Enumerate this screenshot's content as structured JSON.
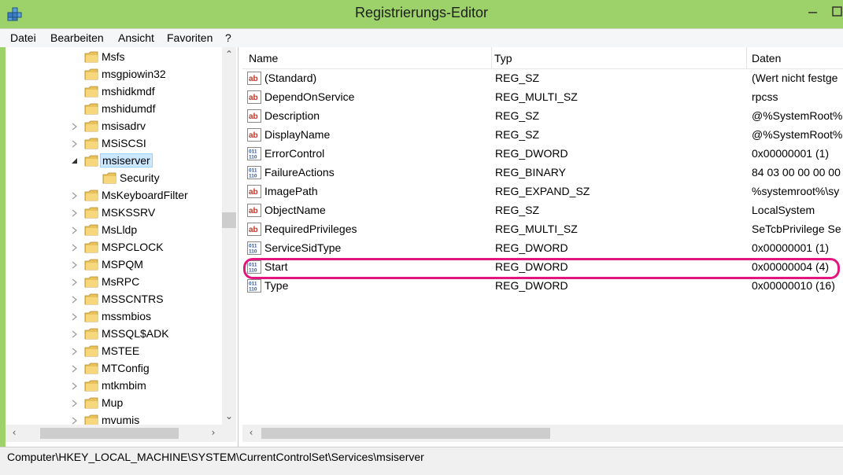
{
  "window": {
    "title": "Registrierungs-Editor"
  },
  "menu": [
    "Datei",
    "Bearbeiten",
    "Ansicht",
    "Favoriten",
    "?"
  ],
  "tree": [
    {
      "label": "Msfs",
      "expander": "none",
      "level": 1
    },
    {
      "label": "msgpiowin32",
      "expander": "none",
      "level": 1
    },
    {
      "label": "mshidkmdf",
      "expander": "none",
      "level": 1
    },
    {
      "label": "mshidumdf",
      "expander": "none",
      "level": 1
    },
    {
      "label": "msisadrv",
      "expander": "collapsed",
      "level": 1
    },
    {
      "label": "MSiSCSI",
      "expander": "collapsed",
      "level": 1
    },
    {
      "label": "msiserver",
      "expander": "expanded",
      "level": 1,
      "selected": true
    },
    {
      "label": "Security",
      "expander": "none",
      "level": 2
    },
    {
      "label": "MsKeyboardFilter",
      "expander": "collapsed",
      "level": 1
    },
    {
      "label": "MSKSSRV",
      "expander": "collapsed",
      "level": 1
    },
    {
      "label": "MsLldp",
      "expander": "collapsed",
      "level": 1
    },
    {
      "label": "MSPCLOCK",
      "expander": "collapsed",
      "level": 1
    },
    {
      "label": "MSPQM",
      "expander": "collapsed",
      "level": 1
    },
    {
      "label": "MsRPC",
      "expander": "collapsed",
      "level": 1
    },
    {
      "label": "MSSCNTRS",
      "expander": "collapsed",
      "level": 1
    },
    {
      "label": "mssmbios",
      "expander": "collapsed",
      "level": 1
    },
    {
      "label": "MSSQL$ADK",
      "expander": "collapsed",
      "level": 1
    },
    {
      "label": "MSTEE",
      "expander": "collapsed",
      "level": 1
    },
    {
      "label": "MTConfig",
      "expander": "collapsed",
      "level": 1
    },
    {
      "label": "mtkmbim",
      "expander": "collapsed",
      "level": 1
    },
    {
      "label": "Mup",
      "expander": "collapsed",
      "level": 1
    },
    {
      "label": "mvumis",
      "expander": "collapsed",
      "level": 1
    }
  ],
  "columns": {
    "name": "Name",
    "type": "Typ",
    "data": "Daten"
  },
  "values": [
    {
      "name": "(Standard)",
      "type": "REG_SZ",
      "data": "(Wert nicht festge",
      "icon": "string-value-icon"
    },
    {
      "name": "DependOnService",
      "type": "REG_MULTI_SZ",
      "data": "rpcss",
      "icon": "string-value-icon"
    },
    {
      "name": "Description",
      "type": "REG_SZ",
      "data": "@%SystemRoot%",
      "icon": "string-value-icon"
    },
    {
      "name": "DisplayName",
      "type": "REG_SZ",
      "data": "@%SystemRoot%",
      "icon": "string-value-icon"
    },
    {
      "name": "ErrorControl",
      "type": "REG_DWORD",
      "data": "0x00000001 (1)",
      "icon": "binary-value-icon"
    },
    {
      "name": "FailureActions",
      "type": "REG_BINARY",
      "data": "84 03 00 00 00 00",
      "icon": "binary-value-icon"
    },
    {
      "name": "ImagePath",
      "type": "REG_EXPAND_SZ",
      "data": "%systemroot%\\sy",
      "icon": "string-value-icon"
    },
    {
      "name": "ObjectName",
      "type": "REG_SZ",
      "data": "LocalSystem",
      "icon": "string-value-icon"
    },
    {
      "name": "RequiredPrivileges",
      "type": "REG_MULTI_SZ",
      "data": "SeTcbPrivilege Se",
      "icon": "string-value-icon"
    },
    {
      "name": "ServiceSidType",
      "type": "REG_DWORD",
      "data": "0x00000001 (1)",
      "icon": "binary-value-icon"
    },
    {
      "name": "Start",
      "type": "REG_DWORD",
      "data": "0x00000004 (4)",
      "icon": "binary-value-icon",
      "highlighted": true
    },
    {
      "name": "Type",
      "type": "REG_DWORD",
      "data": "0x00000010 (16)",
      "icon": "binary-value-icon"
    }
  ],
  "status": {
    "path": "Computer\\HKEY_LOCAL_MACHINE\\SYSTEM\\CurrentControlSet\\Services\\msiserver"
  },
  "colors": {
    "titlebar": "#9dd26a",
    "highlight_ring": "#e5157f",
    "selection": "#cce8ff"
  }
}
